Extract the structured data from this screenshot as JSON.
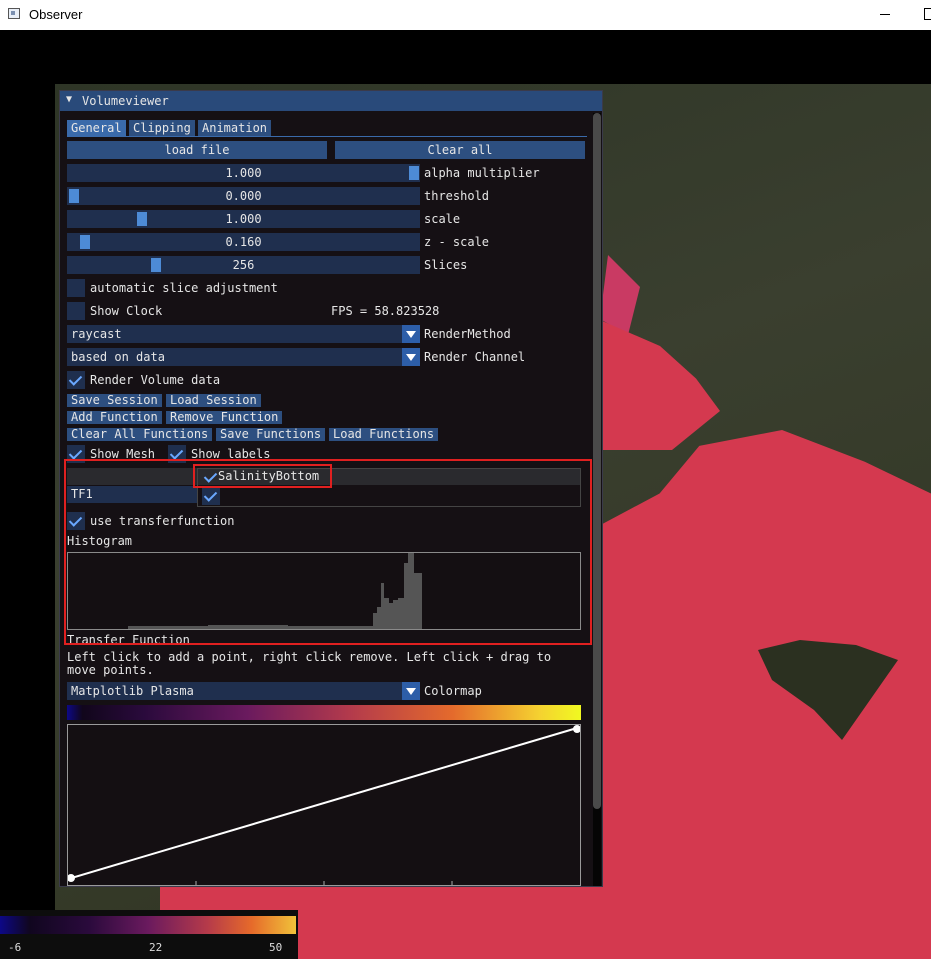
{
  "window": {
    "title": "Observer"
  },
  "panel": {
    "title": "Volumeviewer",
    "tabs": [
      "General",
      "Clipping",
      "Animation"
    ],
    "load_file": "load file",
    "clear_all": "Clear all",
    "sliders": [
      {
        "value": "1.000",
        "label": "alpha multiplier",
        "level": 1.0
      },
      {
        "value": "0.000",
        "label": "threshold",
        "level": 0.0
      },
      {
        "value": "1.000",
        "label": "scale",
        "level": 0.21
      },
      {
        "value": "0.160",
        "label": "z - scale",
        "level": 0.05
      },
      {
        "value": "256",
        "label": "Slices",
        "level": 0.25
      }
    ],
    "auto_slice": "automatic slice adjustment",
    "show_clock": "Show Clock",
    "fps": "FPS = 58.823528",
    "render_method": {
      "value": "raycast",
      "label": "RenderMethod"
    },
    "render_channel": {
      "value": "based on data",
      "label": "Render Channel"
    },
    "render_volume": "Render Volume data",
    "session_buttons": [
      "Save Session",
      "Load Session"
    ],
    "function_buttons": [
      "Add Function",
      "Remove Function"
    ],
    "function_buttons2": [
      "Clear All Functions",
      "Save Functions",
      "Load Functions"
    ],
    "show_mesh": "Show Mesh",
    "show_labels": "Show labels",
    "table": {
      "column": "SalinityBottom",
      "row": "TF1"
    },
    "use_tf": "use transferfunction",
    "histogram_label": "Histogram",
    "transfer_label": "Transfer Function",
    "hint": "Left click to add a point, right click remove. Left click + drag to move points.",
    "colormap": {
      "value": "Matplotlib Plasma",
      "label": "Colormap"
    }
  },
  "colorbar": {
    "min": "-6",
    "mid": "22",
    "max": "50"
  },
  "colors": {
    "accent": "#2d4f80",
    "highlight": "#e02020",
    "water": "#d4394f"
  }
}
